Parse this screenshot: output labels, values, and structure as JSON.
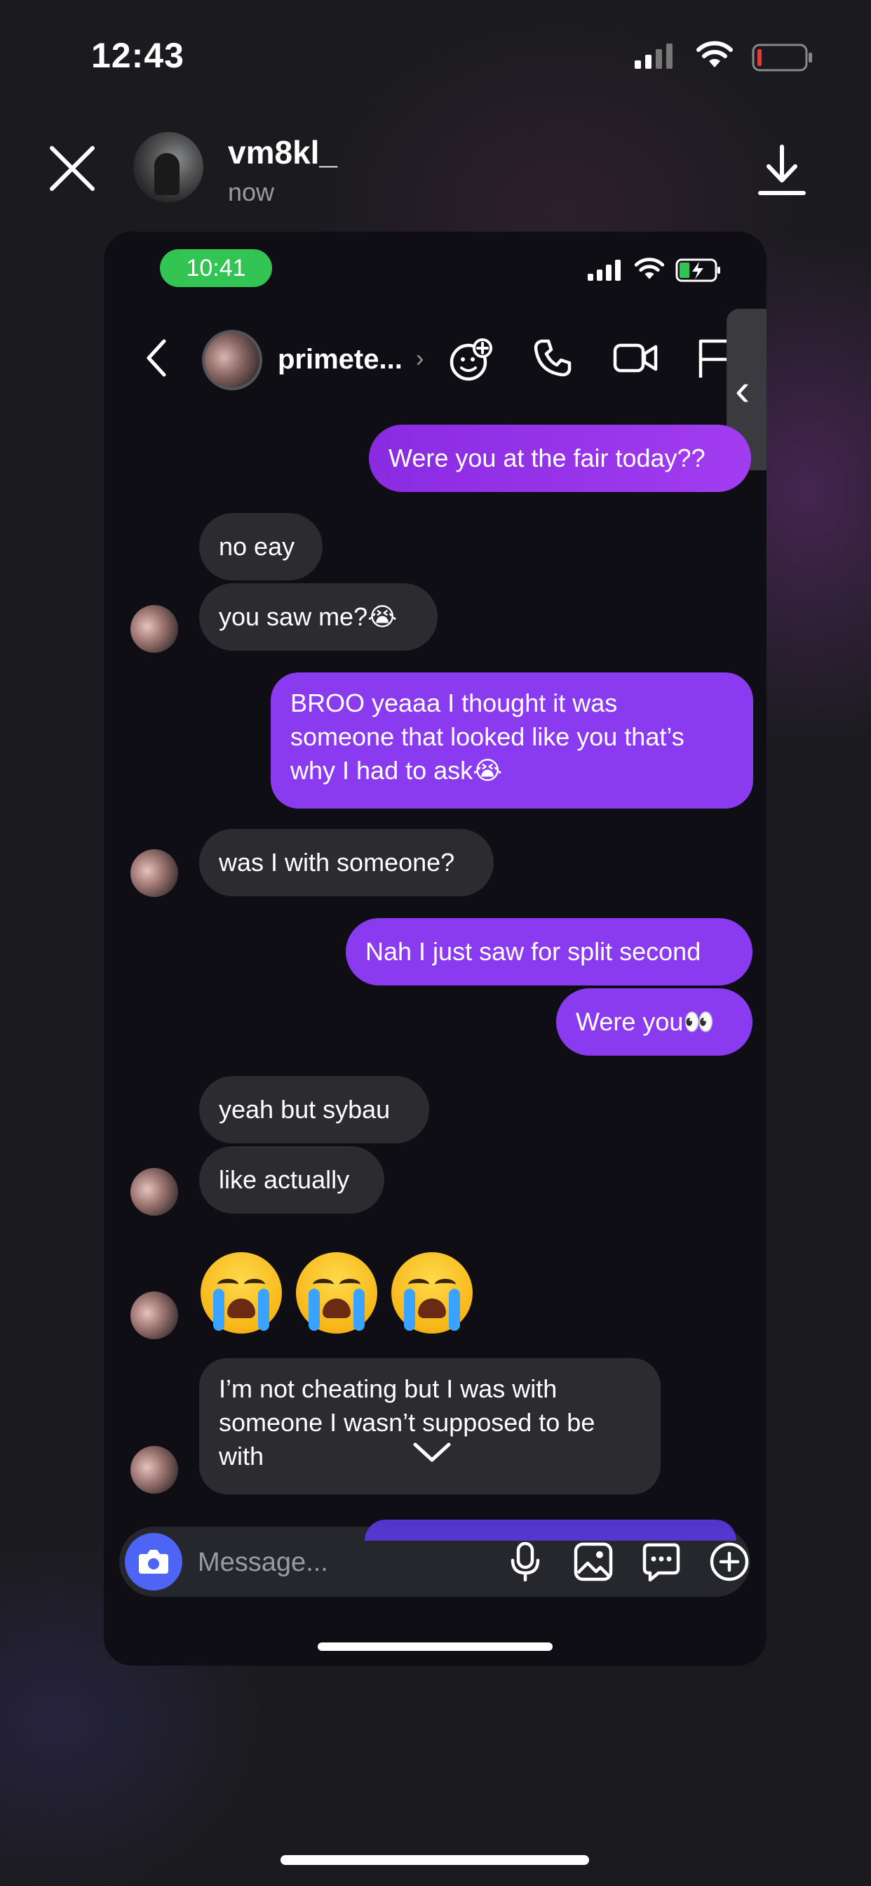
{
  "status_bar": {
    "time": "12:43"
  },
  "story": {
    "username": "vm8kl_",
    "time": "now",
    "icons": [
      "close-icon",
      "download-icon"
    ]
  },
  "screenshot": {
    "status_time": "10:41",
    "chat": {
      "name": "primete...",
      "icons": [
        "back-icon",
        "effects-icon",
        "phone-icon",
        "video-icon",
        "flag-icon"
      ]
    },
    "messages": [
      {
        "side": "out",
        "text": "Were you at the fair today??"
      },
      {
        "side": "in",
        "text": "no eay"
      },
      {
        "side": "in",
        "text": "you saw me?😭"
      },
      {
        "side": "out",
        "text_lines": [
          "BROO yeaaa I thought it was",
          "someone that looked like you that’s",
          "why I had to ask😭"
        ]
      },
      {
        "side": "in",
        "text": "was I with someone?"
      },
      {
        "side": "out",
        "text": "Nah I just saw for split second"
      },
      {
        "side": "out",
        "text": "Were you👀"
      },
      {
        "side": "in",
        "text": "yeah but sybau"
      },
      {
        "side": "in",
        "text": "like actually"
      },
      {
        "side": "in",
        "emoji": "😭😭😭"
      },
      {
        "side": "in",
        "text_lines": [
          "I’m not cheating but I was with",
          "someone I wasn’t supposed to be",
          "with"
        ]
      }
    ],
    "composer": {
      "placeholder": "Message...",
      "icons": [
        "camera-icon",
        "mic-icon",
        "image-icon",
        "sticker-icon",
        "plus-icon"
      ]
    }
  },
  "colors": {
    "outgoing": "#8a3bf0",
    "incoming": "#2b2b30",
    "camera_button": "#4e64f5",
    "status_pill": "#32c554"
  }
}
